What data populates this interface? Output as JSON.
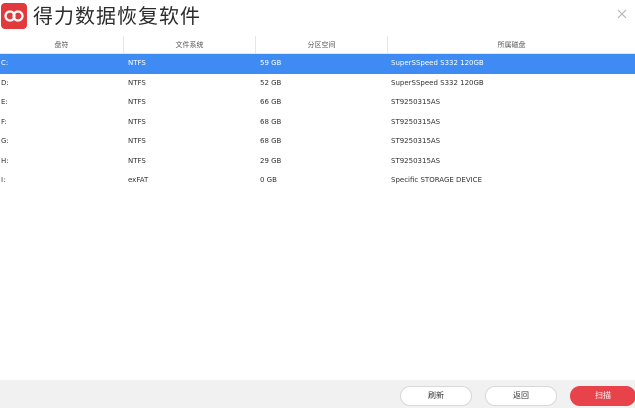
{
  "app": {
    "title": "得力数据恢复软件",
    "brand_color": "#e23a3a"
  },
  "table": {
    "headers": [
      "盘符",
      "文件系统",
      "分区空间",
      "所属磁盘"
    ],
    "selected_row": 0,
    "selected_color": "#3e8cf3",
    "rows": [
      {
        "drive": "C:",
        "fs": "NTFS",
        "size": "59 GB",
        "disk": "SuperSSpeed S332 120GB"
      },
      {
        "drive": "D:",
        "fs": "NTFS",
        "size": "52 GB",
        "disk": "SuperSSpeed S332 120GB"
      },
      {
        "drive": "E:",
        "fs": "NTFS",
        "size": "66 GB",
        "disk": "ST9250315AS"
      },
      {
        "drive": "F:",
        "fs": "NTFS",
        "size": "68 GB",
        "disk": "ST9250315AS"
      },
      {
        "drive": "G:",
        "fs": "NTFS",
        "size": "68 GB",
        "disk": "ST9250315AS"
      },
      {
        "drive": "H:",
        "fs": "NTFS",
        "size": "29 GB",
        "disk": "ST9250315AS"
      },
      {
        "drive": "I:",
        "fs": "exFAT",
        "size": "0 GB",
        "disk": "Specific STORAGE DEVICE"
      }
    ]
  },
  "footer": {
    "refresh_label": "刷新",
    "back_label": "返回",
    "scan_label": "扫描",
    "scan_color": "#e8434b"
  },
  "icons": {
    "logo": "infinity-logo-icon",
    "close": "close-icon"
  }
}
